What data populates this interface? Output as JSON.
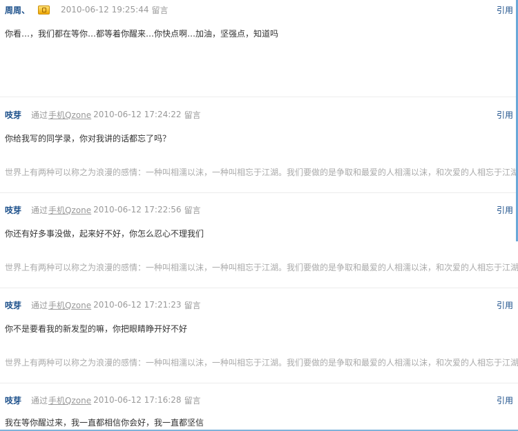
{
  "entries": [
    {
      "author": "周周、",
      "has_badge": true,
      "via": "",
      "device": "",
      "time": "2010-06-12 19:25:44",
      "msg_label": "留言",
      "reply": "引用",
      "text": "你看…，我们都在等你…都等着你醒来…你快点啊…加油，坚强点，知道吗",
      "signature": ""
    },
    {
      "author": "吱芽",
      "has_badge": false,
      "via": "通过",
      "device": "手机Qzone",
      "time": "2010-06-12 17:24:22",
      "msg_label": "留言",
      "reply": "引用",
      "text": "你给我写的同学录，你对我讲的话都忘了吗？",
      "signature": "世界上有两种可以称之为浪漫的感情：一种叫相濡以沫，一种叫相忘于江湖。我们要做的是争取和最爱的人相濡以沫，和次爱的人相忘于江湖"
    },
    {
      "author": "吱芽",
      "has_badge": false,
      "via": "通过",
      "device": "手机Qzone",
      "time": "2010-06-12 17:22:56",
      "msg_label": "留言",
      "reply": "引用",
      "text": "你还有好多事没做，起来好不好，你怎么忍心不理我们",
      "signature": "世界上有两种可以称之为浪漫的感情：一种叫相濡以沫，一种叫相忘于江湖。我们要做的是争取和最爱的人相濡以沫，和次爱的人相忘于江湖"
    },
    {
      "author": "吱芽",
      "has_badge": false,
      "via": "通过",
      "device": "手机Qzone",
      "time": "2010-06-12 17:21:23",
      "msg_label": "留言",
      "reply": "引用",
      "text": "你不是要看我的新发型的嘛，你把眼睛睁开好不好",
      "signature": "世界上有两种可以称之为浪漫的感情：一种叫相濡以沫，一种叫相忘于江湖。我们要做的是争取和最爱的人相濡以沫，和次爱的人相忘于江湖"
    },
    {
      "author": "吱芽",
      "has_badge": false,
      "via": "通过",
      "device": "手机Qzone",
      "time": "2010-06-12 17:16:28",
      "msg_label": "留言",
      "reply": "引用",
      "text": "我在等你醒过来，我一直都相信你会好，我一直都坚信",
      "signature": ""
    }
  ]
}
